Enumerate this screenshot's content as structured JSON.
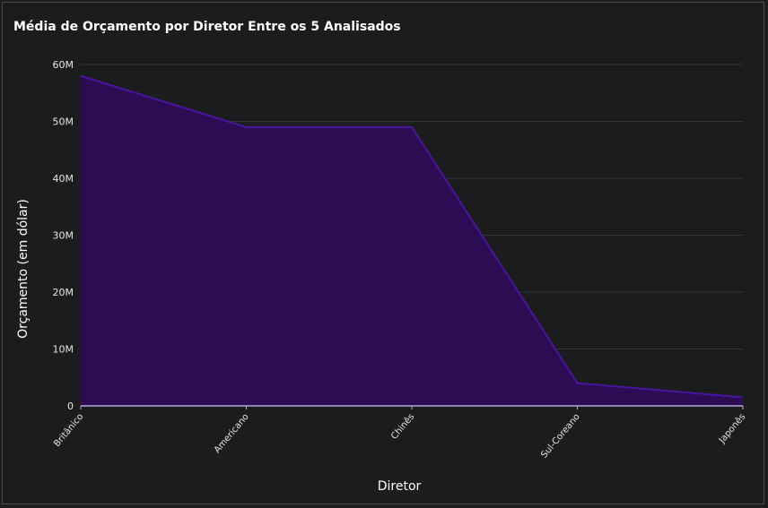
{
  "chart_data": {
    "type": "area",
    "title": "Média de Orçamento por Diretor Entre os 5 Analisados",
    "xlabel": "Diretor",
    "ylabel": "Orçamento (em dólar)",
    "categories": [
      "Britânico",
      "Americano",
      "Chinês",
      "Sul-Coreano",
      "Japonês"
    ],
    "values": [
      58000000,
      49000000,
      49000000,
      4000000,
      1500000
    ],
    "ylim": [
      0,
      60000000
    ],
    "yticks": [
      0,
      10000000,
      20000000,
      30000000,
      40000000,
      50000000,
      60000000
    ],
    "ytick_labels": [
      "0",
      "10M",
      "20M",
      "30M",
      "40M",
      "50M",
      "60M"
    ],
    "grid": true,
    "colors": {
      "fill": "#2c0d54",
      "line": "#4a14a3",
      "axis": "#b8a8d8"
    }
  }
}
